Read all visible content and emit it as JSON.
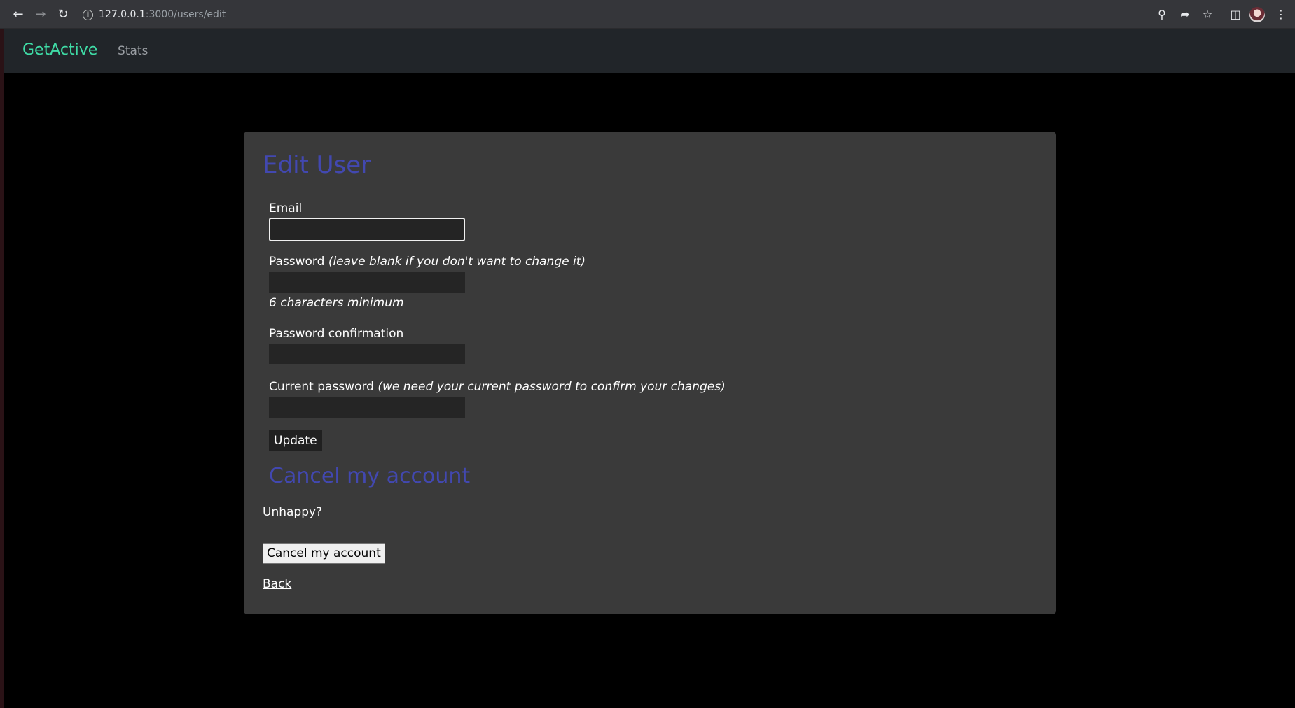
{
  "browser": {
    "url_host": "127.0.0.1",
    "url_path": ":3000/users/edit"
  },
  "nav": {
    "brand": "GetActive",
    "links": [
      "Stats"
    ]
  },
  "form": {
    "title": "Edit User",
    "email_label": "Email",
    "email_value": "",
    "password_label": "Password",
    "password_hint": "(leave blank if you don't want to change it)",
    "password_value": "",
    "password_min": "6 characters minimum",
    "password_confirmation_label": "Password confirmation",
    "current_password_label": "Current password",
    "current_password_hint": "(we need your current password to confirm your changes)",
    "update_button": "Update"
  },
  "cancel_section": {
    "title": "Cancel my account",
    "prompt": "Unhappy?",
    "button": "Cancel my account"
  },
  "back_link": "Back",
  "colors": {
    "brand": "#3fdca6",
    "heading": "#4248b0",
    "card": "#3a3a3a",
    "nav": "#212529"
  }
}
